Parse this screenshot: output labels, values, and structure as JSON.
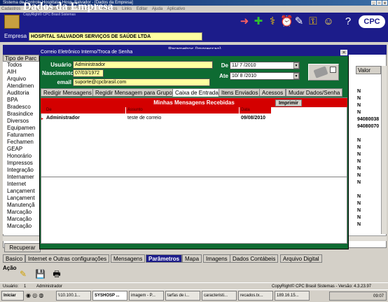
{
  "window": {
    "title": "Sistema de Controle Hospitalar Hosp. Salvador - [Dados da Empresa]",
    "controls": [
      "_",
      "▫",
      "x"
    ]
  },
  "menu": [
    "Cadastros",
    "Marcação",
    "Atendimento",
    "Relatórios",
    "Utilitários",
    "Links",
    "Editar",
    "Ajuda",
    "Aplicativo"
  ],
  "header": {
    "title": "Dados da Empresa",
    "subtitle": "CopyRight© CPC Brasil Sistemas",
    "empresa_label": "Empresa",
    "empresa_value": "HOSPITAL SALVADOR SERVIÇOS DE SAÚDE LTDA"
  },
  "background_panel": {
    "strip_title": "Parametros (Impressao)",
    "tipo_header": "Tipo de Parc",
    "tipo_items": [
      "Todos",
      "AIH",
      "Arquivo",
      "Atendimen",
      "Auditoria",
      "BPA",
      "Bradesco",
      "Brasindice",
      "Diversos",
      "Equipamen",
      "Faturamen",
      "Fechamen",
      "GEAP",
      "Honorário",
      "Impressos",
      "Integração",
      "Internamer",
      "Internet",
      "Lançament",
      "Lançament",
      "Manutençã",
      "Marcação",
      "Marcação",
      "Marcação"
    ],
    "valor_header": "Valor",
    "valor_items": [
      "",
      "",
      "N",
      "N",
      "N",
      "N",
      "94080038",
      "94080070",
      "",
      "N",
      "N",
      "N",
      "N",
      "N",
      "N",
      "N",
      "",
      "N",
      "N",
      "N",
      "N",
      "N"
    ],
    "recuperar_label": "Recuperar"
  },
  "bottom_tabs": [
    "Basico",
    "Internet e Outras configurações",
    "Mensagens",
    "Parâmetros",
    "Mapa",
    "Imagens",
    "Dados Contábeis",
    "Arquivo Digital"
  ],
  "bottom_active_tab": "Parâmetros",
  "acao_label": "Ação",
  "status": {
    "usuario_label": "Usuário:",
    "usuario_value": "1",
    "usuario_name": "Administrador",
    "copyright": "CopyRight© CPC Brasil Sistemas - Versão: 4.3.23.97"
  },
  "taskbar": {
    "start_label": "Iniciar",
    "buttons": [
      "\\\\10.100.1...",
      "SYSHOSP ...",
      "imagem - P...",
      "tarfas de i...",
      "caracteristi...",
      "recados.tx...",
      "189.16.15..."
    ],
    "clock": "09:07"
  },
  "dialog": {
    "title": "Correio Eletrônico Interno/Troca de Senha",
    "usuario_label": "Usuário",
    "usuario_value": "Administrador",
    "nascimento_label": "Nascimento",
    "nascimento_value": "07/03/1972",
    "email_label": "email",
    "email_value": "suporte@cpcbrasil.com",
    "de_label": "De",
    "de_value": "11/ 7 /2010",
    "ate_label": "Ate",
    "ate_value": "10/ 8 /2010",
    "tabs": [
      "Redigir Mensagens",
      "Regidir Mensagem para Grupo",
      "Caixa de Entrada",
      "Itens Enviados",
      "Acessos",
      "Mudar Dados/Senha"
    ],
    "active_tab": "Caixa de Entrada",
    "inbox_title": "Minhas Mensagens Recebidas",
    "imprimir_label": "Imprimir",
    "columns": [
      "De",
      "Assunto",
      "Data"
    ],
    "messages": [
      {
        "de": "Administrador",
        "assunto": "teste de correio",
        "data": "09/08/2010"
      }
    ]
  }
}
